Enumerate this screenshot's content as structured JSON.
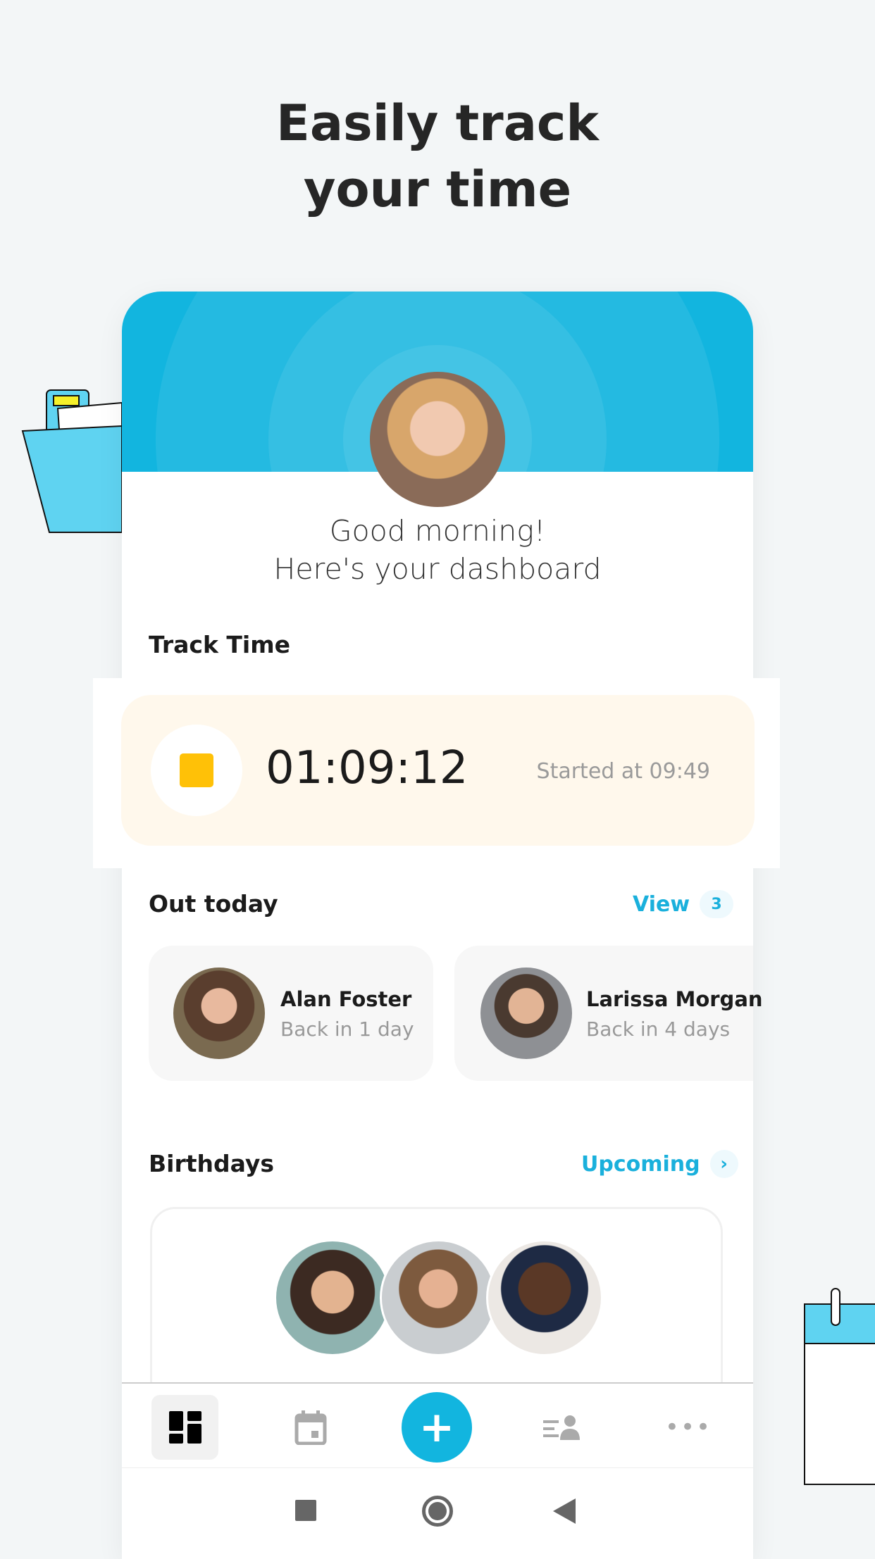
{
  "headline": {
    "line1": "Easily track",
    "line2": "your time"
  },
  "greeting": {
    "line1": "Good morning!",
    "line2": "Here's your dashboard"
  },
  "track_time": {
    "title": "Track Time",
    "elapsed": "01:09:12",
    "started": "Started at 09:49",
    "stop_color": "#ffc107"
  },
  "out_today": {
    "title": "Out today",
    "view_label": "View",
    "count": "3",
    "people": [
      {
        "name": "Alan Foster",
        "status": "Back in 1 day"
      },
      {
        "name": "Larissa Morgan",
        "status": "Back in 4 days"
      }
    ]
  },
  "birthdays": {
    "title": "Birthdays",
    "upcoming_label": "Upcoming"
  },
  "nav": {
    "items": [
      "dashboard-icon",
      "calendar-icon",
      "add-icon",
      "people-list-icon",
      "more-icon"
    ],
    "accent": "#12b5df"
  },
  "colors": {
    "brand": "#12b5df",
    "timer_bg": "#fff8ec"
  }
}
